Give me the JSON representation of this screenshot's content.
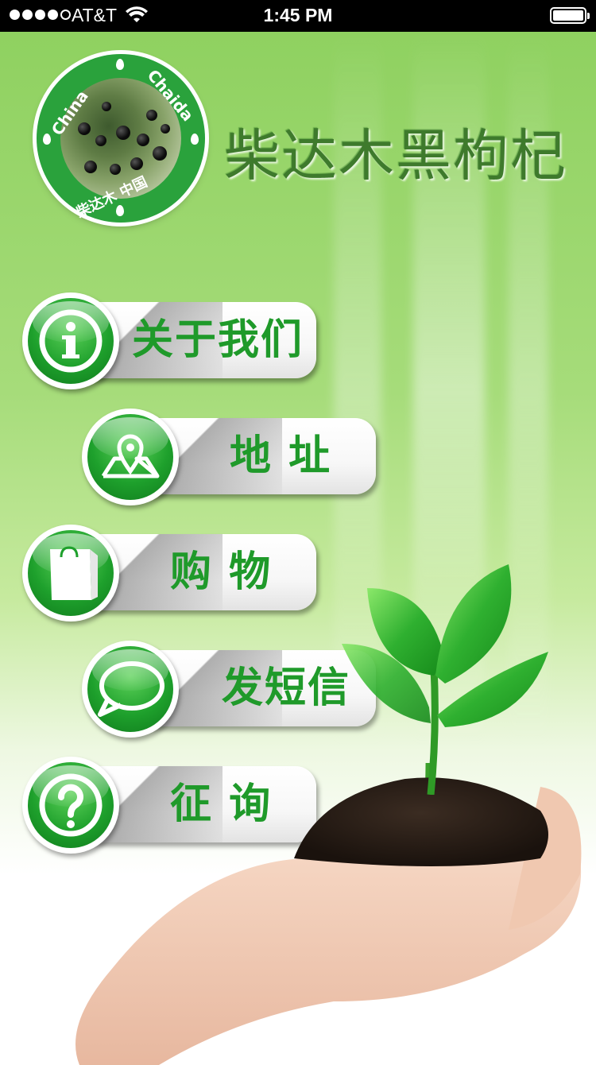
{
  "status_bar": {
    "carrier": "AT&T",
    "time": "1:45 PM"
  },
  "header": {
    "app_title": "柴达木黑枸杞",
    "logo_text_left": "China",
    "logo_text_right": "Chaida",
    "logo_text_bottom": "柴达木 中国"
  },
  "menu": {
    "items": [
      {
        "label": "关于我们",
        "icon": "info-icon"
      },
      {
        "label": "地 址",
        "icon": "map-pin-icon"
      },
      {
        "label": "购 物",
        "icon": "shopping-bag-icon"
      },
      {
        "label": "发短信",
        "icon": "chat-bubble-icon"
      },
      {
        "label": "征 询",
        "icon": "question-icon"
      }
    ]
  },
  "colors": {
    "accent_green": "#1f9a2a",
    "title_green": "#3e7a2c",
    "status_bar_bg": "#000000"
  }
}
